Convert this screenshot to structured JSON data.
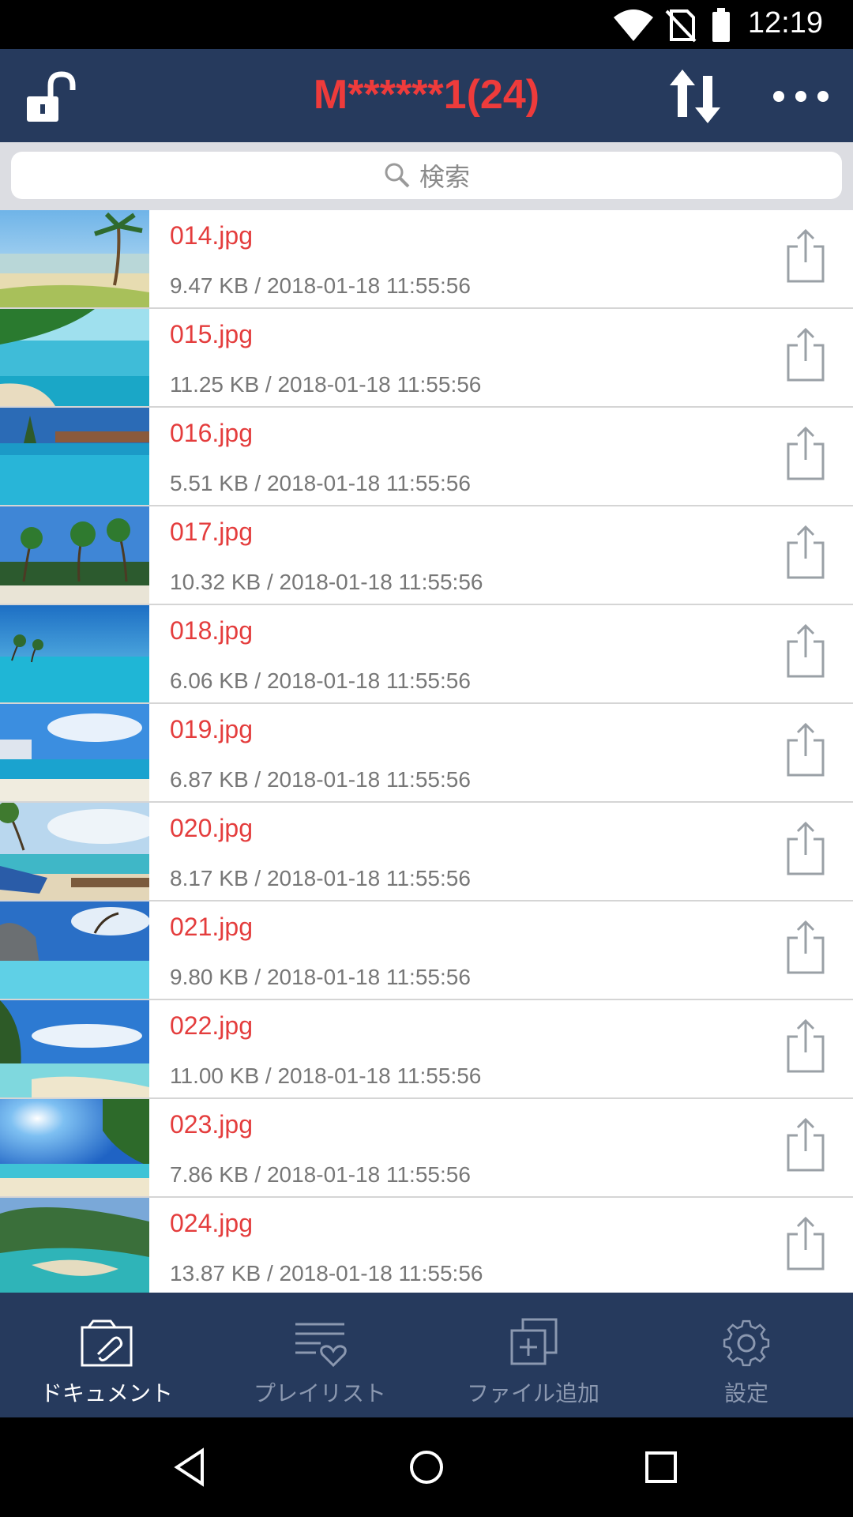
{
  "status": {
    "time": "12:19"
  },
  "header": {
    "title": "M******1(24)"
  },
  "search": {
    "placeholder": "検索"
  },
  "files": [
    {
      "name": "014.jpg",
      "meta": "9.47 KB / 2018-01-18 11:55:56"
    },
    {
      "name": "015.jpg",
      "meta": "11.25 KB / 2018-01-18 11:55:56"
    },
    {
      "name": "016.jpg",
      "meta": "5.51 KB / 2018-01-18 11:55:56"
    },
    {
      "name": "017.jpg",
      "meta": "10.32 KB / 2018-01-18 11:55:56"
    },
    {
      "name": "018.jpg",
      "meta": "6.06 KB / 2018-01-18 11:55:56"
    },
    {
      "name": "019.jpg",
      "meta": "6.87 KB / 2018-01-18 11:55:56"
    },
    {
      "name": "020.jpg",
      "meta": "8.17 KB / 2018-01-18 11:55:56"
    },
    {
      "name": "021.jpg",
      "meta": "9.80 KB / 2018-01-18 11:55:56"
    },
    {
      "name": "022.jpg",
      "meta": "11.00 KB / 2018-01-18 11:55:56"
    },
    {
      "name": "023.jpg",
      "meta": "7.86 KB / 2018-01-18 11:55:56"
    },
    {
      "name": "024.jpg",
      "meta": "13.87 KB / 2018-01-18 11:55:56"
    }
  ],
  "tabs": [
    {
      "label": "ドキュメント",
      "icon": "document-icon"
    },
    {
      "label": "プレイリスト",
      "icon": "playlist-icon"
    },
    {
      "label": "ファイル追加",
      "icon": "add-file-icon"
    },
    {
      "label": "設定",
      "icon": "gear-icon"
    }
  ],
  "colors": {
    "accent": "#e43d3d",
    "bar": "#263a5d"
  }
}
